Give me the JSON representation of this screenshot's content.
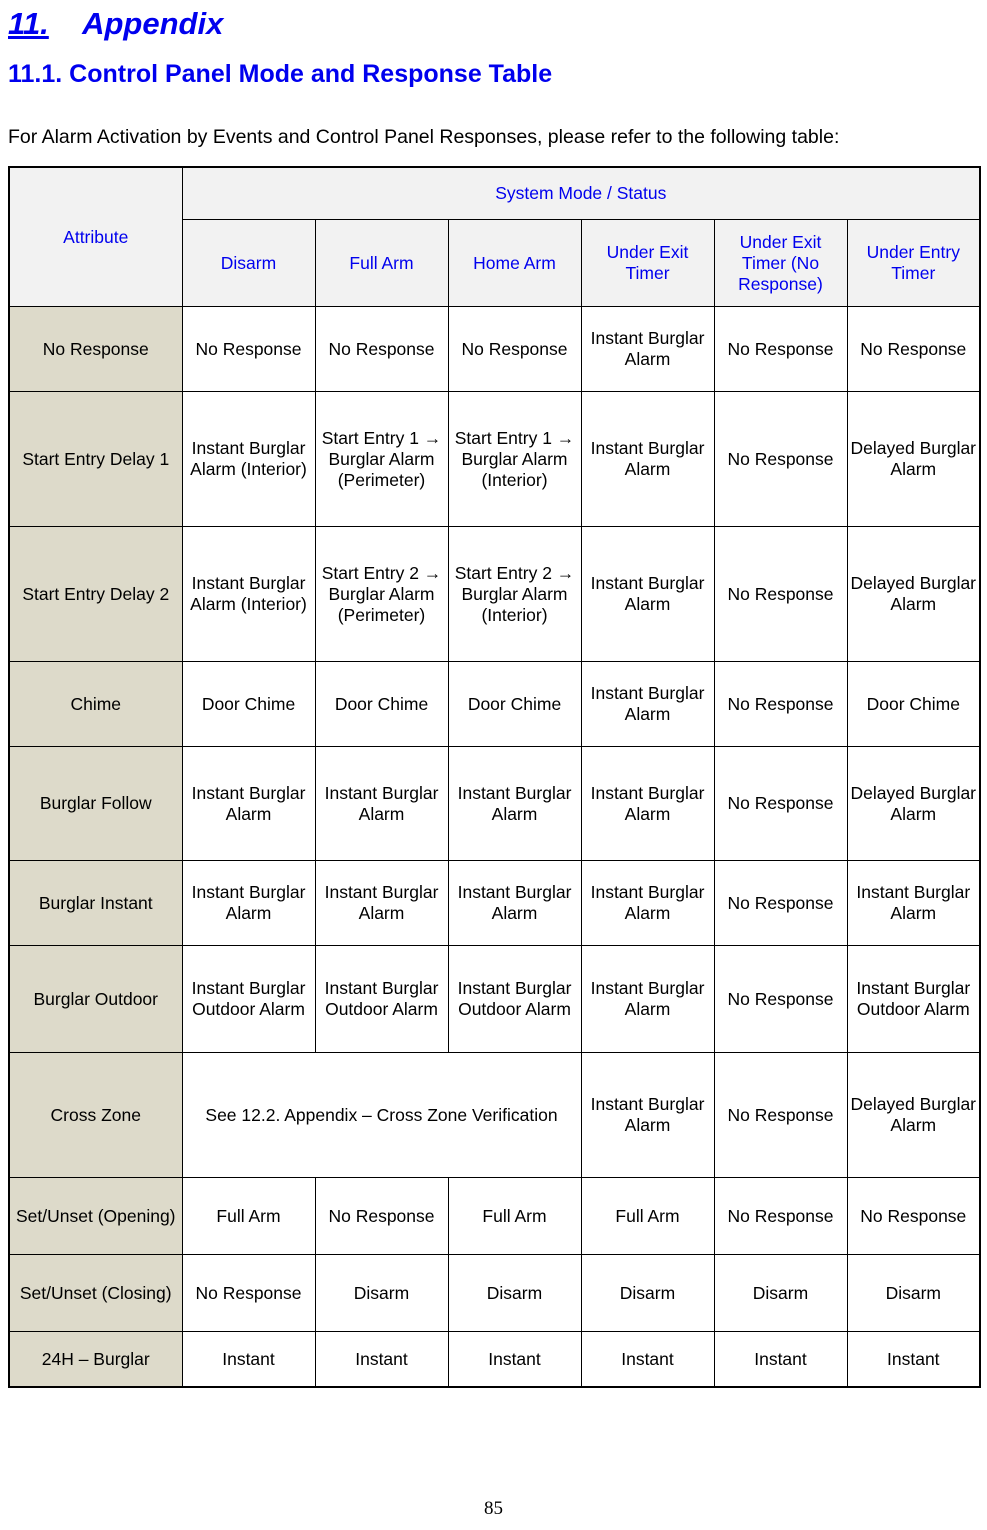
{
  "heading": {
    "chapter_number": "11.",
    "chapter_title": "Appendix",
    "section_title": "11.1. Control Panel Mode and Response Table"
  },
  "intro_text": "For Alarm Activation by Events and Control Panel Responses, please refer to the following table:",
  "colors": {
    "heading_blue": "#0000EE",
    "header_bg": "#F2F2F2",
    "row_label_bg": "#DDDACA",
    "cell_bg": "#FFFFFF",
    "border": "#000000"
  },
  "table": {
    "group_header": "System Mode / Status",
    "attribute_header": "Attribute",
    "columns": [
      "Disarm",
      "Full Arm",
      "Home Arm",
      "Under Exit Timer",
      "Under Exit Timer (No Response)",
      "Under Entry Timer"
    ],
    "rows": [
      {
        "label": "No Response",
        "cells": [
          "No Response",
          "No Response",
          "No Response",
          "Instant Burglar Alarm",
          "No Response",
          "No Response"
        ]
      },
      {
        "label": "Start Entry Delay 1",
        "cells": [
          "Instant Burglar Alarm (Interior)",
          "Start Entry 1 → Burglar Alarm (Perimeter)",
          "Start Entry 1 → Burglar Alarm (Interior)",
          "Instant Burglar Alarm",
          "No Response",
          "Delayed Burglar Alarm"
        ]
      },
      {
        "label": "Start Entry Delay 2",
        "cells": [
          "Instant Burglar Alarm (Interior)",
          "Start Entry 2 → Burglar Alarm (Perimeter)",
          "Start Entry 2 → Burglar Alarm (Interior)",
          "Instant Burglar Alarm",
          "No Response",
          "Delayed Burglar Alarm"
        ]
      },
      {
        "label": "Chime",
        "cells": [
          "Door Chime",
          "Door Chime",
          "Door Chime",
          "Instant Burglar Alarm",
          "No Response",
          "Door Chime"
        ]
      },
      {
        "label": "Burglar Follow",
        "cells": [
          "Instant Burglar Alarm",
          "Instant Burglar Alarm",
          "Instant Burglar Alarm",
          "Instant Burglar Alarm",
          "No Response",
          "Delayed Burglar Alarm"
        ]
      },
      {
        "label": "Burglar Instant",
        "cells": [
          "Instant Burglar Alarm",
          "Instant Burglar Alarm",
          "Instant Burglar Alarm",
          "Instant Burglar Alarm",
          "No Response",
          "Instant Burglar Alarm"
        ]
      },
      {
        "label": "Burglar Outdoor",
        "cells": [
          "Instant Burglar Outdoor Alarm",
          "Instant Burglar Outdoor Alarm",
          "Instant Burglar Outdoor Alarm",
          "Instant Burglar Alarm",
          "No Response",
          "Instant Burglar Outdoor Alarm"
        ]
      },
      {
        "label": "Cross Zone",
        "merged_note": "See 12.2. Appendix – Cross Zone Verification",
        "cells": [
          "Instant Burglar Alarm",
          "No Response",
          "Delayed Burglar Alarm"
        ]
      },
      {
        "label": "Set/Unset (Opening)",
        "cells": [
          "Full Arm",
          "No Response",
          "Full Arm",
          "Full Arm",
          "No Response",
          "No Response"
        ]
      },
      {
        "label": "Set/Unset (Closing)",
        "cells": [
          "No Response",
          "Disarm",
          "Disarm",
          "Disarm",
          "Disarm",
          "Disarm"
        ]
      },
      {
        "label": "24H – Burglar",
        "cells": [
          "Instant",
          "Instant",
          "Instant",
          "Instant",
          "Instant",
          "Instant"
        ]
      }
    ]
  },
  "page_number": "85"
}
